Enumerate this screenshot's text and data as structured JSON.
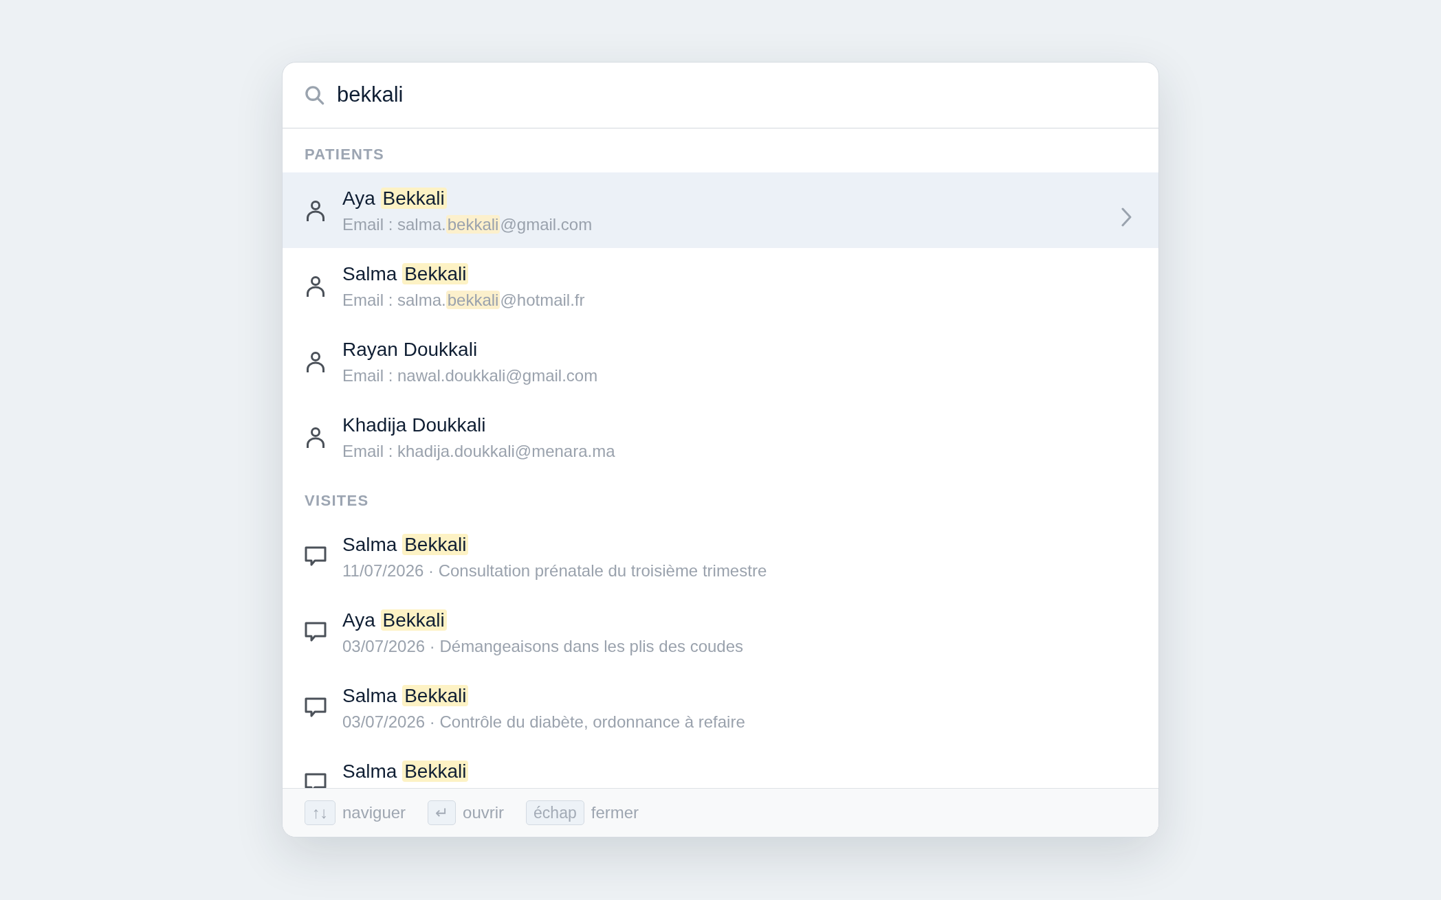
{
  "search": {
    "value": "bekkali"
  },
  "sections": [
    {
      "title": "PATIENTS",
      "kind": "patient",
      "items": [
        {
          "selected": true,
          "name": [
            {
              "text": "Aya ",
              "match": false
            },
            {
              "text": "Bekkali",
              "match": true
            }
          ],
          "detail": [
            {
              "text": "Email : salma.",
              "match": false
            },
            {
              "text": "bekkali",
              "match": true
            },
            {
              "text": "@gmail.com",
              "match": false
            }
          ]
        },
        {
          "selected": false,
          "name": [
            {
              "text": "Salma ",
              "match": false
            },
            {
              "text": "Bekkali",
              "match": true
            }
          ],
          "detail": [
            {
              "text": "Email : salma.",
              "match": false
            },
            {
              "text": "bekkali",
              "match": true
            },
            {
              "text": "@hotmail.fr",
              "match": false
            }
          ]
        },
        {
          "selected": false,
          "name": [
            {
              "text": "Rayan Doukkali",
              "match": false
            }
          ],
          "detail": [
            {
              "text": "Email : nawal.doukkali@gmail.com",
              "match": false
            }
          ]
        },
        {
          "selected": false,
          "name": [
            {
              "text": "Khadija Doukkali",
              "match": false
            }
          ],
          "detail": [
            {
              "text": "Email : khadija.doukkali@menara.ma",
              "match": false
            }
          ]
        }
      ]
    },
    {
      "title": "VISITES",
      "kind": "visit",
      "items": [
        {
          "selected": false,
          "name": [
            {
              "text": "Salma ",
              "match": false
            },
            {
              "text": "Bekkali",
              "match": true
            }
          ],
          "detail": [
            {
              "text": "11/07/2026 · Consultation prénatale du troisième trimestre",
              "match": false
            }
          ]
        },
        {
          "selected": false,
          "name": [
            {
              "text": "Aya ",
              "match": false
            },
            {
              "text": "Bekkali",
              "match": true
            }
          ],
          "detail": [
            {
              "text": "03/07/2026 · Démangeaisons dans les plis des coudes",
              "match": false
            }
          ]
        },
        {
          "selected": false,
          "name": [
            {
              "text": "Salma ",
              "match": false
            },
            {
              "text": "Bekkali",
              "match": true
            }
          ],
          "detail": [
            {
              "text": "03/07/2026 · Contrôle du diabète, ordonnance à refaire",
              "match": false
            }
          ]
        },
        {
          "selected": false,
          "name": [
            {
              "text": "Salma ",
              "match": false
            },
            {
              "text": "Bekkali",
              "match": true
            }
          ]
        }
      ]
    }
  ],
  "footer": {
    "hints": [
      {
        "key": "↑↓",
        "label": "naviguer"
      },
      {
        "key": "↵",
        "label": "ouvrir"
      },
      {
        "key": "échap",
        "label": "fermer"
      }
    ]
  }
}
